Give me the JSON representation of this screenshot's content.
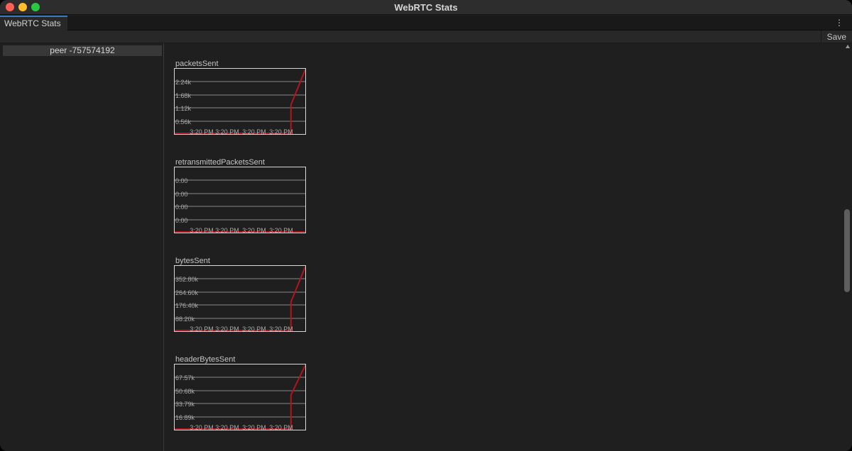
{
  "window": {
    "title": "WebRTC Stats"
  },
  "tabs": [
    {
      "label": "WebRTC Stats"
    }
  ],
  "menu": {
    "icon": "kebab-menu-icon",
    "glyph": "⋮"
  },
  "toolbar": {
    "save_label": "Save"
  },
  "sidebar": {
    "items": [
      {
        "label": "peer -757574192"
      }
    ]
  },
  "colors": {
    "accent_tab": "#3a79bb",
    "series_line": "#b5141d",
    "grid": "#8a8a8a",
    "border": "#d8d8d8"
  },
  "chart_data": [
    {
      "type": "line",
      "title": "packetsSent",
      "y_ticks": [
        "2.24k",
        "1.68k",
        "1.12k",
        "0.56k"
      ],
      "x_ticks": [
        "3:20 PM",
        "3:20 PM",
        "3:20 PM",
        "3:20 PM"
      ],
      "ylim": [
        0,
        2800
      ],
      "series": [
        {
          "x": [
            0,
            0.89,
            0.89,
            1.0
          ],
          "values": [
            0,
            0,
            1250,
            2800
          ]
        }
      ]
    },
    {
      "type": "line",
      "title": "retransmittedPacketsSent",
      "y_ticks": [
        "0.00",
        "0.00",
        "0.00",
        "0.00"
      ],
      "x_ticks": [
        "3:20 PM",
        "3:20 PM",
        "3:20 PM",
        "3:20 PM"
      ],
      "ylim": [
        0,
        1
      ],
      "series": [
        {
          "x": [
            0,
            1.0
          ],
          "values": [
            0,
            0
          ]
        }
      ]
    },
    {
      "type": "line",
      "title": "bytesSent",
      "y_ticks": [
        "352.80k",
        "264.60k",
        "176.40k",
        "88.20k"
      ],
      "x_ticks": [
        "3:20 PM",
        "3:20 PM",
        "3:20 PM",
        "3:20 PM"
      ],
      "ylim": [
        0,
        441000
      ],
      "series": [
        {
          "x": [
            0,
            0.89,
            0.89,
            1.0
          ],
          "values": [
            0,
            0,
            197000,
            441000
          ]
        }
      ]
    },
    {
      "type": "line",
      "title": "headerBytesSent",
      "y_ticks": [
        "67.57k",
        "50.68k",
        "33.79k",
        "16.89k"
      ],
      "x_ticks": [
        "3:20 PM",
        "3:20 PM",
        "3:20 PM",
        "3:20 PM"
      ],
      "ylim": [
        0,
        84460
      ],
      "series": [
        {
          "x": [
            0,
            0.89,
            0.89,
            1.0
          ],
          "values": [
            0,
            0,
            45000,
            84460
          ]
        }
      ]
    }
  ]
}
